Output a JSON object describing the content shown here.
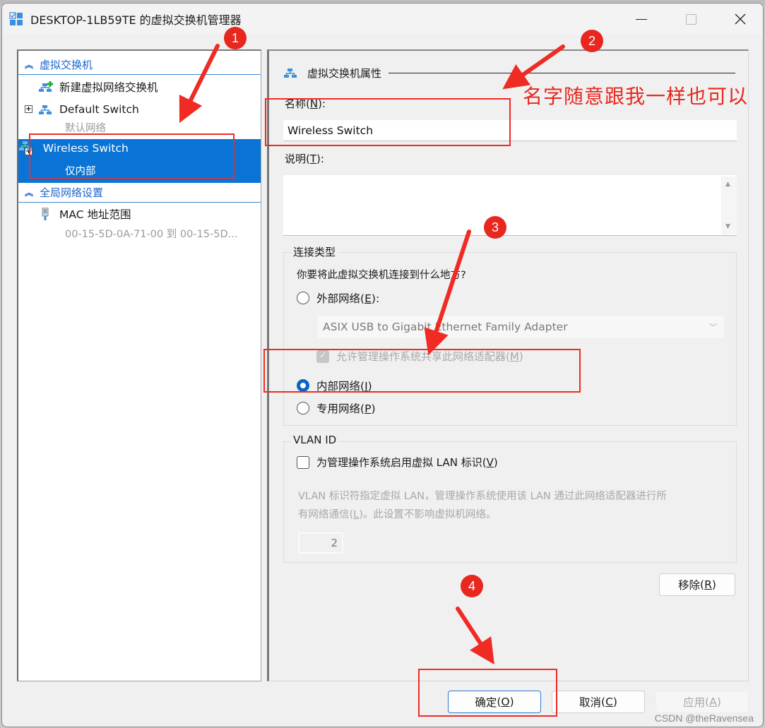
{
  "window": {
    "title": "DESKTOP-1LB59TE 的虚拟交换机管理器",
    "controls": {
      "minimize": "minimize",
      "maximize": "maximize",
      "close": "close"
    }
  },
  "sidebar": {
    "sections": [
      {
        "title": "虚拟交换机",
        "items": [
          {
            "label": "新建虚拟网络交换机",
            "icon": "new-switch-icon"
          },
          {
            "label": "Default Switch",
            "sublabel": "默认网络",
            "expandable": true,
            "icon": "switch-icon"
          },
          {
            "label": "Wireless Switch",
            "sublabel": "仅内部",
            "expandable": true,
            "selected": true,
            "icon": "switch-icon"
          }
        ]
      },
      {
        "title": "全局网络设置",
        "items": [
          {
            "label": "MAC 地址范围",
            "sublabel": "00-15-5D-0A-71-00 到 00-15-5D...",
            "icon": "network-cable-icon"
          }
        ]
      }
    ]
  },
  "properties": {
    "group_title": "虚拟交换机属性",
    "name_label": "名称",
    "name_accel": "N",
    "name_value": "Wireless Switch",
    "notes_label": "说明",
    "notes_accel": "T",
    "notes_value": "",
    "connection_type": {
      "legend": "连接类型",
      "question": "你要将此虚拟交换机连接到什么地方?",
      "options": [
        {
          "label": "外部网络",
          "accel": "E",
          "suffix": ":",
          "checked": false
        },
        {
          "label": "内部网络",
          "accel": "I",
          "checked": true
        },
        {
          "label": "专用网络",
          "accel": "P",
          "checked": false
        }
      ],
      "adapter_selected": "ASIX USB to Gigabit Ethernet Family Adapter",
      "allow_share_label": "允许管理操作系统共享此网络适配器",
      "allow_share_accel": "M",
      "allow_share_checked": true,
      "allow_share_disabled": true
    },
    "vlan": {
      "legend": "VLAN ID",
      "enable_label": "为管理操作系统启用虚拟 LAN 标识",
      "enable_accel": "V",
      "enable_checked": false,
      "description_1": "VLAN 标识符指定虚拟 LAN，管理操作系统使用该 LAN 通过此网络适配器进行所",
      "description_2": "有网络通信",
      "description_accel": "L",
      "description_3": "。此设置不影响虚拟机网络。",
      "vlan_value": "2"
    },
    "remove_button": {
      "label": "移除",
      "accel": "R"
    }
  },
  "footer": {
    "ok": {
      "label": "确定",
      "accel": "O"
    },
    "cancel": {
      "label": "取消",
      "accel": "C"
    },
    "apply": {
      "label": "应用",
      "accel": "A",
      "disabled": true
    }
  },
  "annotations": {
    "badges": [
      "1",
      "2",
      "3",
      "4"
    ],
    "note": "名字随意跟我一样也可以",
    "color": "#e8271f"
  },
  "watermark": "CSDN @theRavensea"
}
